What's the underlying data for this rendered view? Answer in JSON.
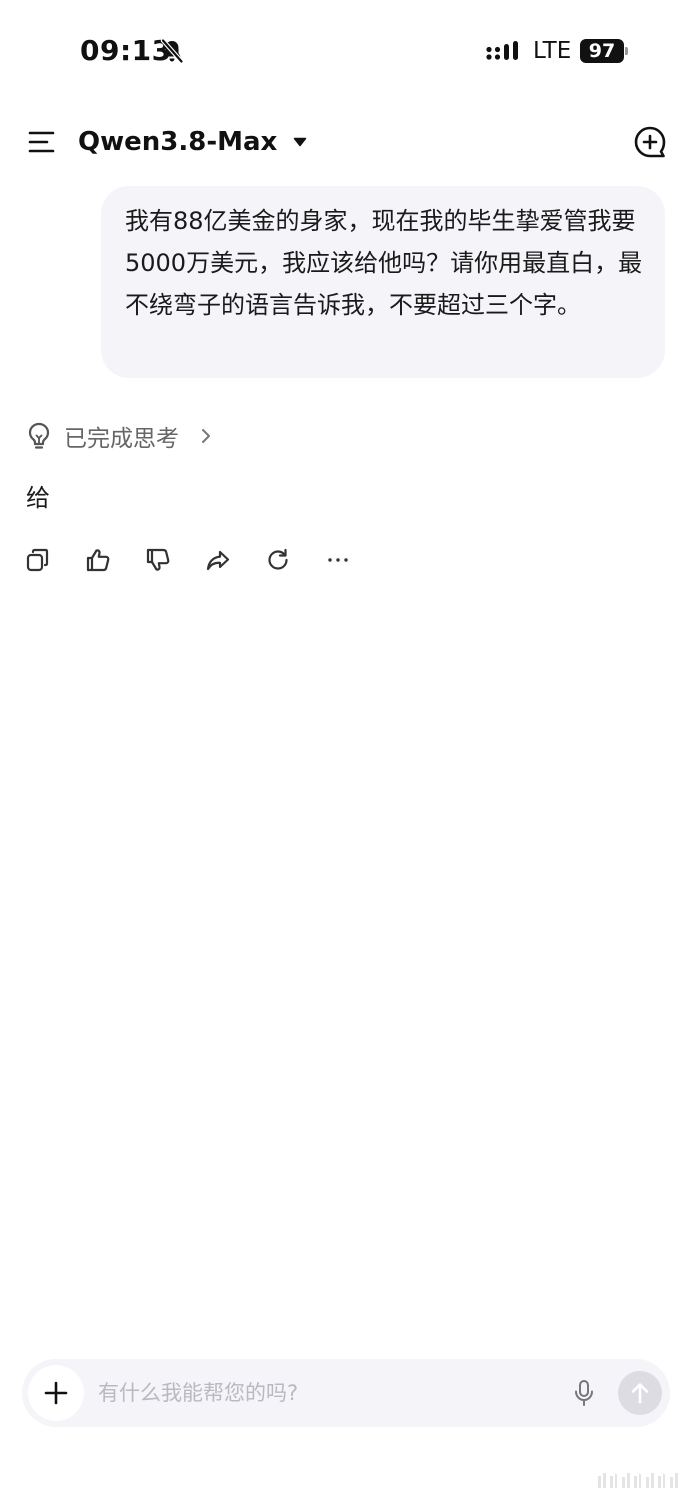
{
  "status_bar": {
    "time": "09:13",
    "network": "LTE",
    "battery": "97",
    "icons": [
      "bell-slash-icon",
      "signal-icon",
      "battery-icon"
    ]
  },
  "header": {
    "model_name": "Qwen3.8-Max",
    "icons": [
      "menu-icon",
      "chevron-down-icon",
      "new-chat-icon"
    ]
  },
  "conversation": {
    "user_message": "我有88亿美金的身家，现在我的毕生挚爱管我要5000万美元，我应该给他吗？请你用最直白，最不绕弯子的语言告诉我，不要超过三个字。",
    "thinking_status": "已完成思考",
    "assistant_answer": "给",
    "actions": [
      "copy-icon",
      "thumbs-up-icon",
      "thumbs-down-icon",
      "share-icon",
      "regenerate-icon",
      "more-icon"
    ]
  },
  "composer": {
    "placeholder": "有什么我能帮您的吗?",
    "value": "",
    "icons": [
      "plus-icon",
      "microphone-icon",
      "send-arrow-icon"
    ]
  },
  "colors": {
    "bubble_bg": "#f4f4f9",
    "input_bg": "#f4f4f9",
    "text_primary": "#1a1a1a",
    "text_secondary": "#666666",
    "placeholder": "#b9b9c0",
    "send_disabled": "#dcdce2"
  }
}
